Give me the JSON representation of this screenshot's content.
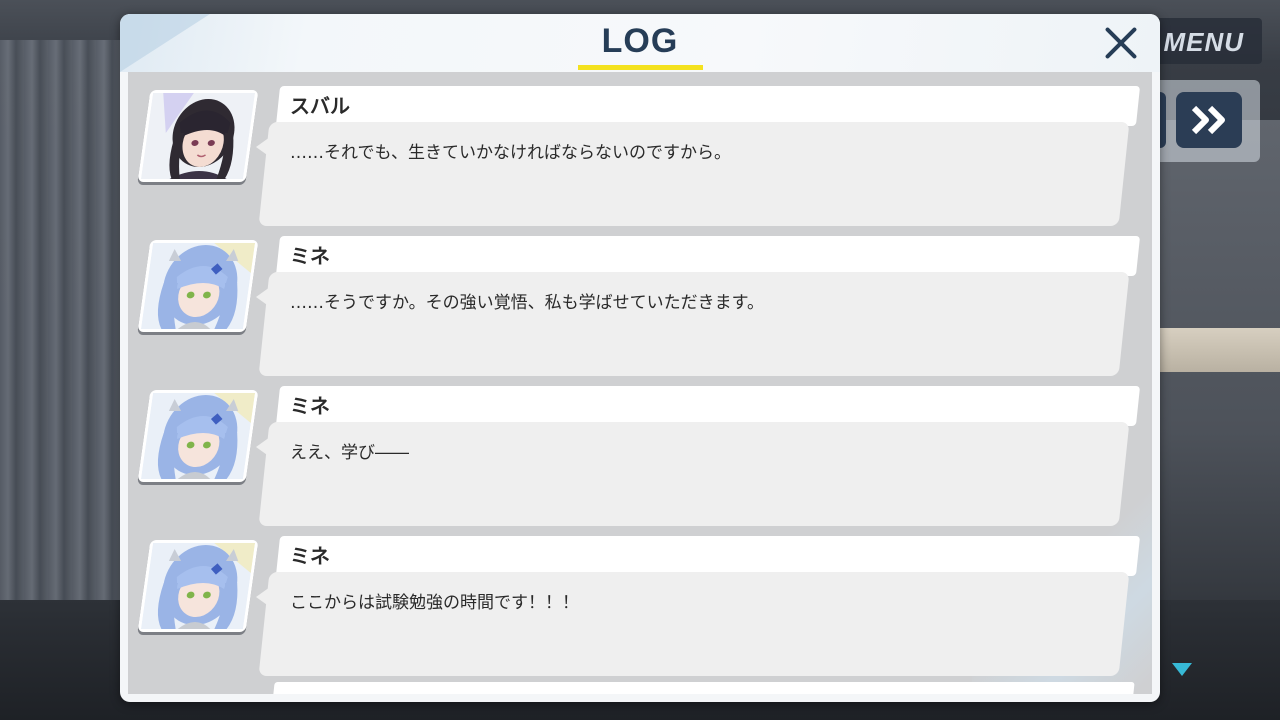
{
  "background_menu": {
    "label": "MENU"
  },
  "log": {
    "title": "LOG",
    "entries": [
      {
        "speaker": "スバル",
        "text": "……それでも、生きていかなければならないのですから。",
        "portrait": "subaru-portrait"
      },
      {
        "speaker": "ミネ",
        "text": "……そうですか。その強い覚悟、私も学ばせていただきます。",
        "portrait": "mine-portrait"
      },
      {
        "speaker": "ミネ",
        "text": "ええ、学び――",
        "portrait": "mine-portrait"
      },
      {
        "speaker": "ミネ",
        "text": "ここからは試験勉強の時間です！！！",
        "portrait": "mine-portrait"
      }
    ]
  },
  "colors": {
    "title": "#263d57",
    "accent_underline": "#f4e21f",
    "scroll_arrow": "#37b9d6",
    "skip_button": "#2b3d55"
  },
  "icons": [
    "close-icon",
    "skip-forward-icon",
    "scroll-down-icon"
  ]
}
